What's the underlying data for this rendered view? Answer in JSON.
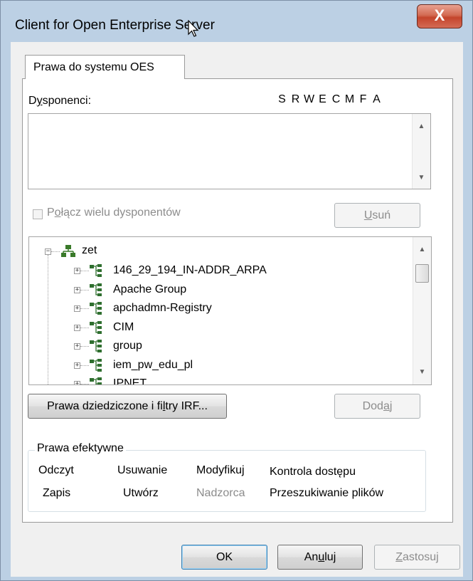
{
  "window": {
    "title": "Client for Open Enterprise Server",
    "close_symbol": "X"
  },
  "tab": {
    "label": "Prawa do systemu OES"
  },
  "trustees": {
    "label": "Dysponenci:",
    "rights_columns": [
      "S",
      "R",
      "W",
      "E",
      "C",
      "M",
      "F",
      "A"
    ]
  },
  "combine": {
    "label": "Połącz wielu dysponentów",
    "checked": false
  },
  "buttons": {
    "remove": "Usuń",
    "inherited": "Prawa dziedziczone i filtry IRF...",
    "add": "Dodaj",
    "ok": "OK",
    "cancel": "Anuluj",
    "apply": "Zastosuj"
  },
  "tree": {
    "root": "zet",
    "items": [
      "146_29_194_IN-ADDR_ARPA",
      "Apache Group",
      "apchadmn-Registry",
      "CIM",
      "group",
      "iem_pw_edu_pl",
      "IPNET"
    ]
  },
  "effective": {
    "title": "Prawa efektywne",
    "row1": [
      "Odczyt",
      "Usuwanie",
      "Modyfikuj",
      "Kontrola dostępu"
    ],
    "row2": [
      "Zapis",
      "Utwórz",
      "Nadzorca",
      "Przeszukiwanie plików"
    ]
  },
  "colors": {
    "title_bar": "#bcd0e4",
    "close_button": "#c4452c",
    "disabled_text": "#8c8c8c"
  }
}
